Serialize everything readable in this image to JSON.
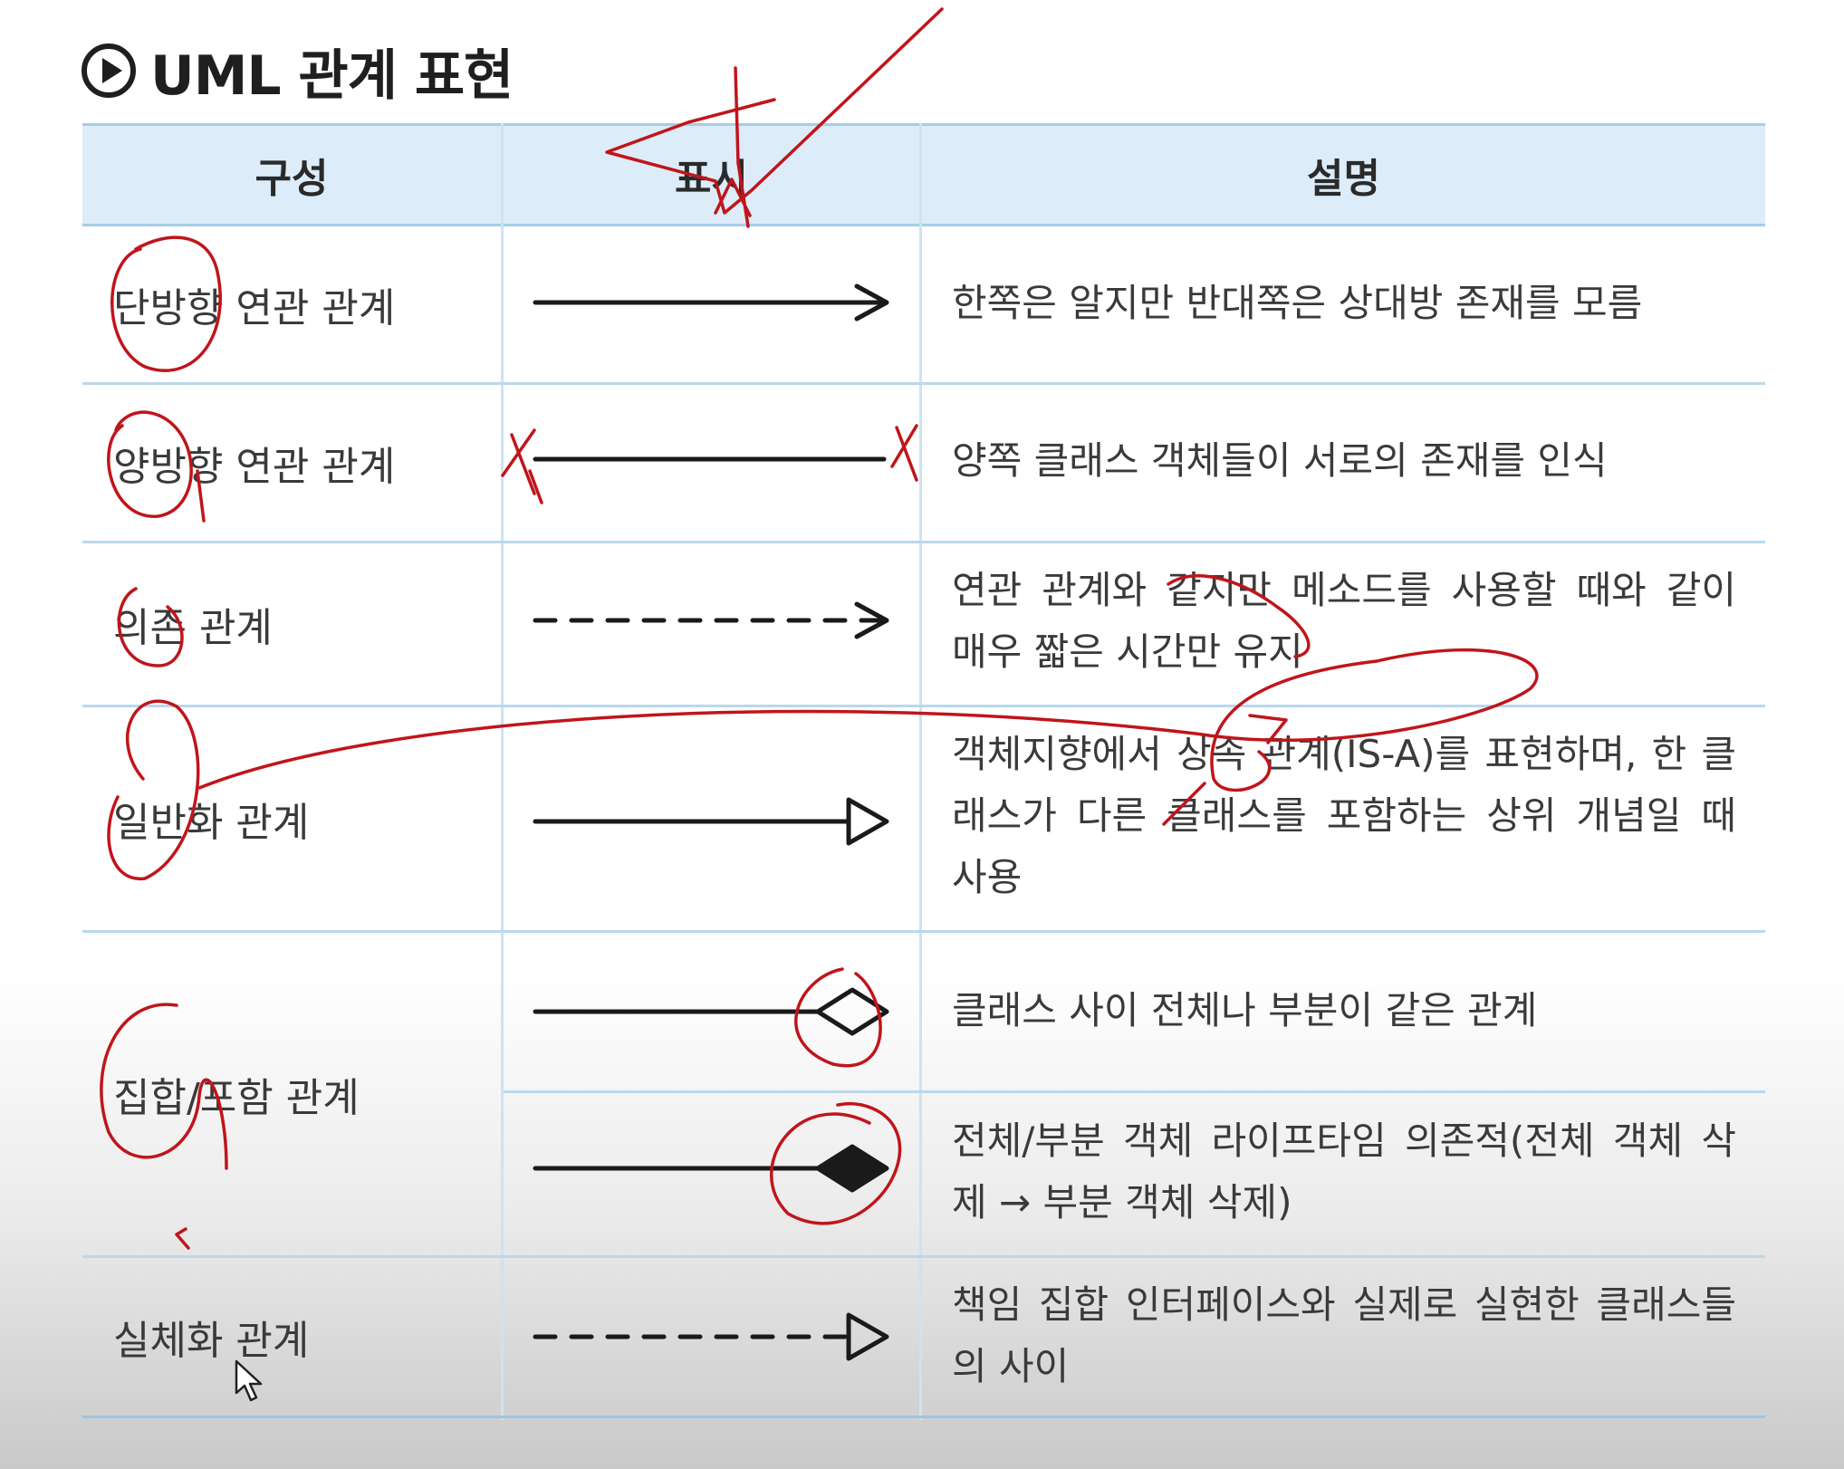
{
  "title": "UML 관계 표현",
  "table": {
    "headers": [
      "구성",
      "표시",
      "설명"
    ],
    "rows": [
      {
        "name": "단방향 연관 관계",
        "notation": "solid line with open arrowhead",
        "description": "한쪽은 알지만 반대쪽은 상대방 존재를 모름"
      },
      {
        "name": "양방향 연관 관계",
        "notation": "solid line, no arrowheads",
        "description": "양쪽 클래스 객체들이 서로의 존재를 인식"
      },
      {
        "name": "의존 관계",
        "notation": "dashed line with open arrowhead",
        "description": "연관 관계와 같지만 메소드를 사용할 때와 같이 매우 짧은 시간만 유지"
      },
      {
        "name": "일반화 관계",
        "notation": "solid line with hollow triangle",
        "description": "객체지향에서 상속 관계(IS-A)를 표현하며, 한 클래스가 다른 클래스를 포함하는 상위 개념일 때 사용"
      },
      {
        "name": "집합/포함 관계",
        "notation": "solid line with hollow diamond",
        "description": "클래스 사이 전체나 부분이 같은 관계"
      },
      {
        "name": "집합/포함 관계",
        "notation": "solid line with filled diamond",
        "description": "전체/부분 객체 라이프타임 의존적(전체 객체 삭제 → 부분 객체 삭제)"
      },
      {
        "name": "실체화 관계",
        "notation": "dashed line with hollow triangle",
        "description": "책임 집합 인터페이스와 실제로 실현한 클래스들의 사이"
      }
    ]
  },
  "colors": {
    "header_bg": "#dcecf8",
    "grid_line": "#b9d8ec",
    "annotation_ink": "#c0151b"
  },
  "icons": [
    "play-circle-icon",
    "mouse-cursor-icon"
  ]
}
